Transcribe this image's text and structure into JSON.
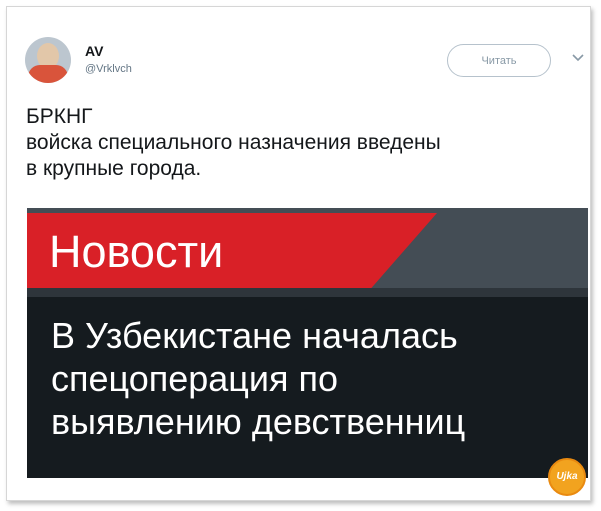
{
  "user": {
    "name": "AV",
    "handle": "@Vrklvch"
  },
  "actions": {
    "follow_label": "Читать"
  },
  "tweet": {
    "lines": [
      "БРКНГ",
      "войска специального назначения введены",
      "в крупные города."
    ]
  },
  "media": {
    "news_label": "Новости",
    "headline_lines": [
      "В Узбекистане началась",
      "спецоперация по",
      "выявлению девственниц"
    ]
  },
  "watermark": {
    "text": "Ujka"
  },
  "colors": {
    "news_red": "#d92027",
    "news_dark": "#151b1f",
    "watermark_orange": "#f2a31f"
  },
  "icons": {
    "menu": "chevron-down-icon"
  }
}
